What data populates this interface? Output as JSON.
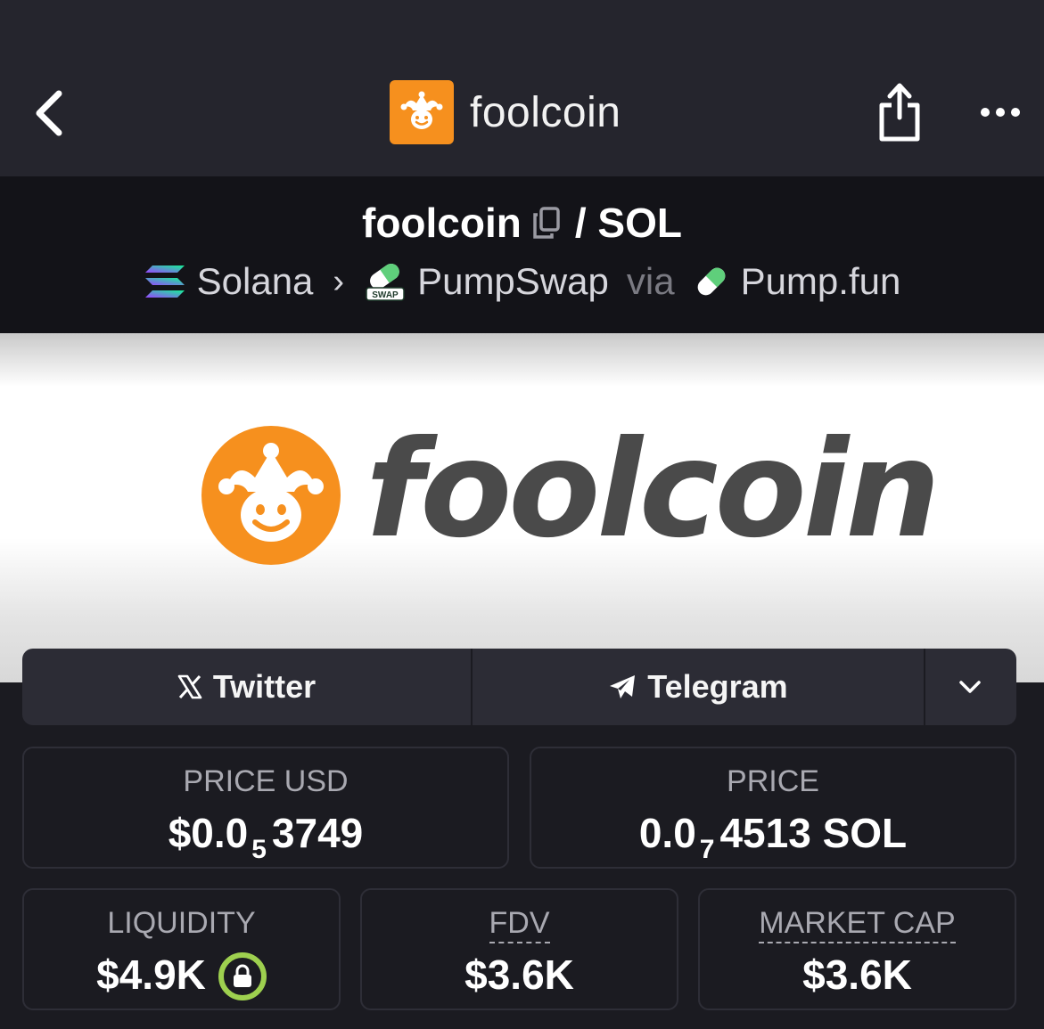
{
  "nav": {
    "title": "foolcoin",
    "back_icon": "chevron-left-icon",
    "share_icon": "share-icon",
    "more_icon": "more-dots-icon",
    "logo_color": "#f6901e"
  },
  "pair": {
    "base": "foolcoin",
    "separator": "/ SOL",
    "chain": "Solana",
    "dex": "PumpSwap",
    "via": "via",
    "launchpad": "Pump.fun",
    "dex_badge": "SWAP"
  },
  "banner": {
    "wordmark": "foolcoin",
    "brand_orange": "#f6901e"
  },
  "social": {
    "twitter_label": "Twitter",
    "telegram_label": "Telegram"
  },
  "stats": {
    "price_usd_label": "PRICE USD",
    "price_usd_prefix": "$0.0",
    "price_usd_zeros": "5",
    "price_usd_digits": "3749",
    "price_label": "PRICE",
    "price_prefix": "0.0",
    "price_zeros": "7",
    "price_digits": "4513 SOL",
    "liquidity_label": "LIQUIDITY",
    "liquidity_value": "$4.9K",
    "fdv_label": "FDV",
    "fdv_value": "$3.6K",
    "mcap_label": "MARKET CAP",
    "mcap_value": "$3.6K",
    "lock_color": "#9ed04f"
  }
}
